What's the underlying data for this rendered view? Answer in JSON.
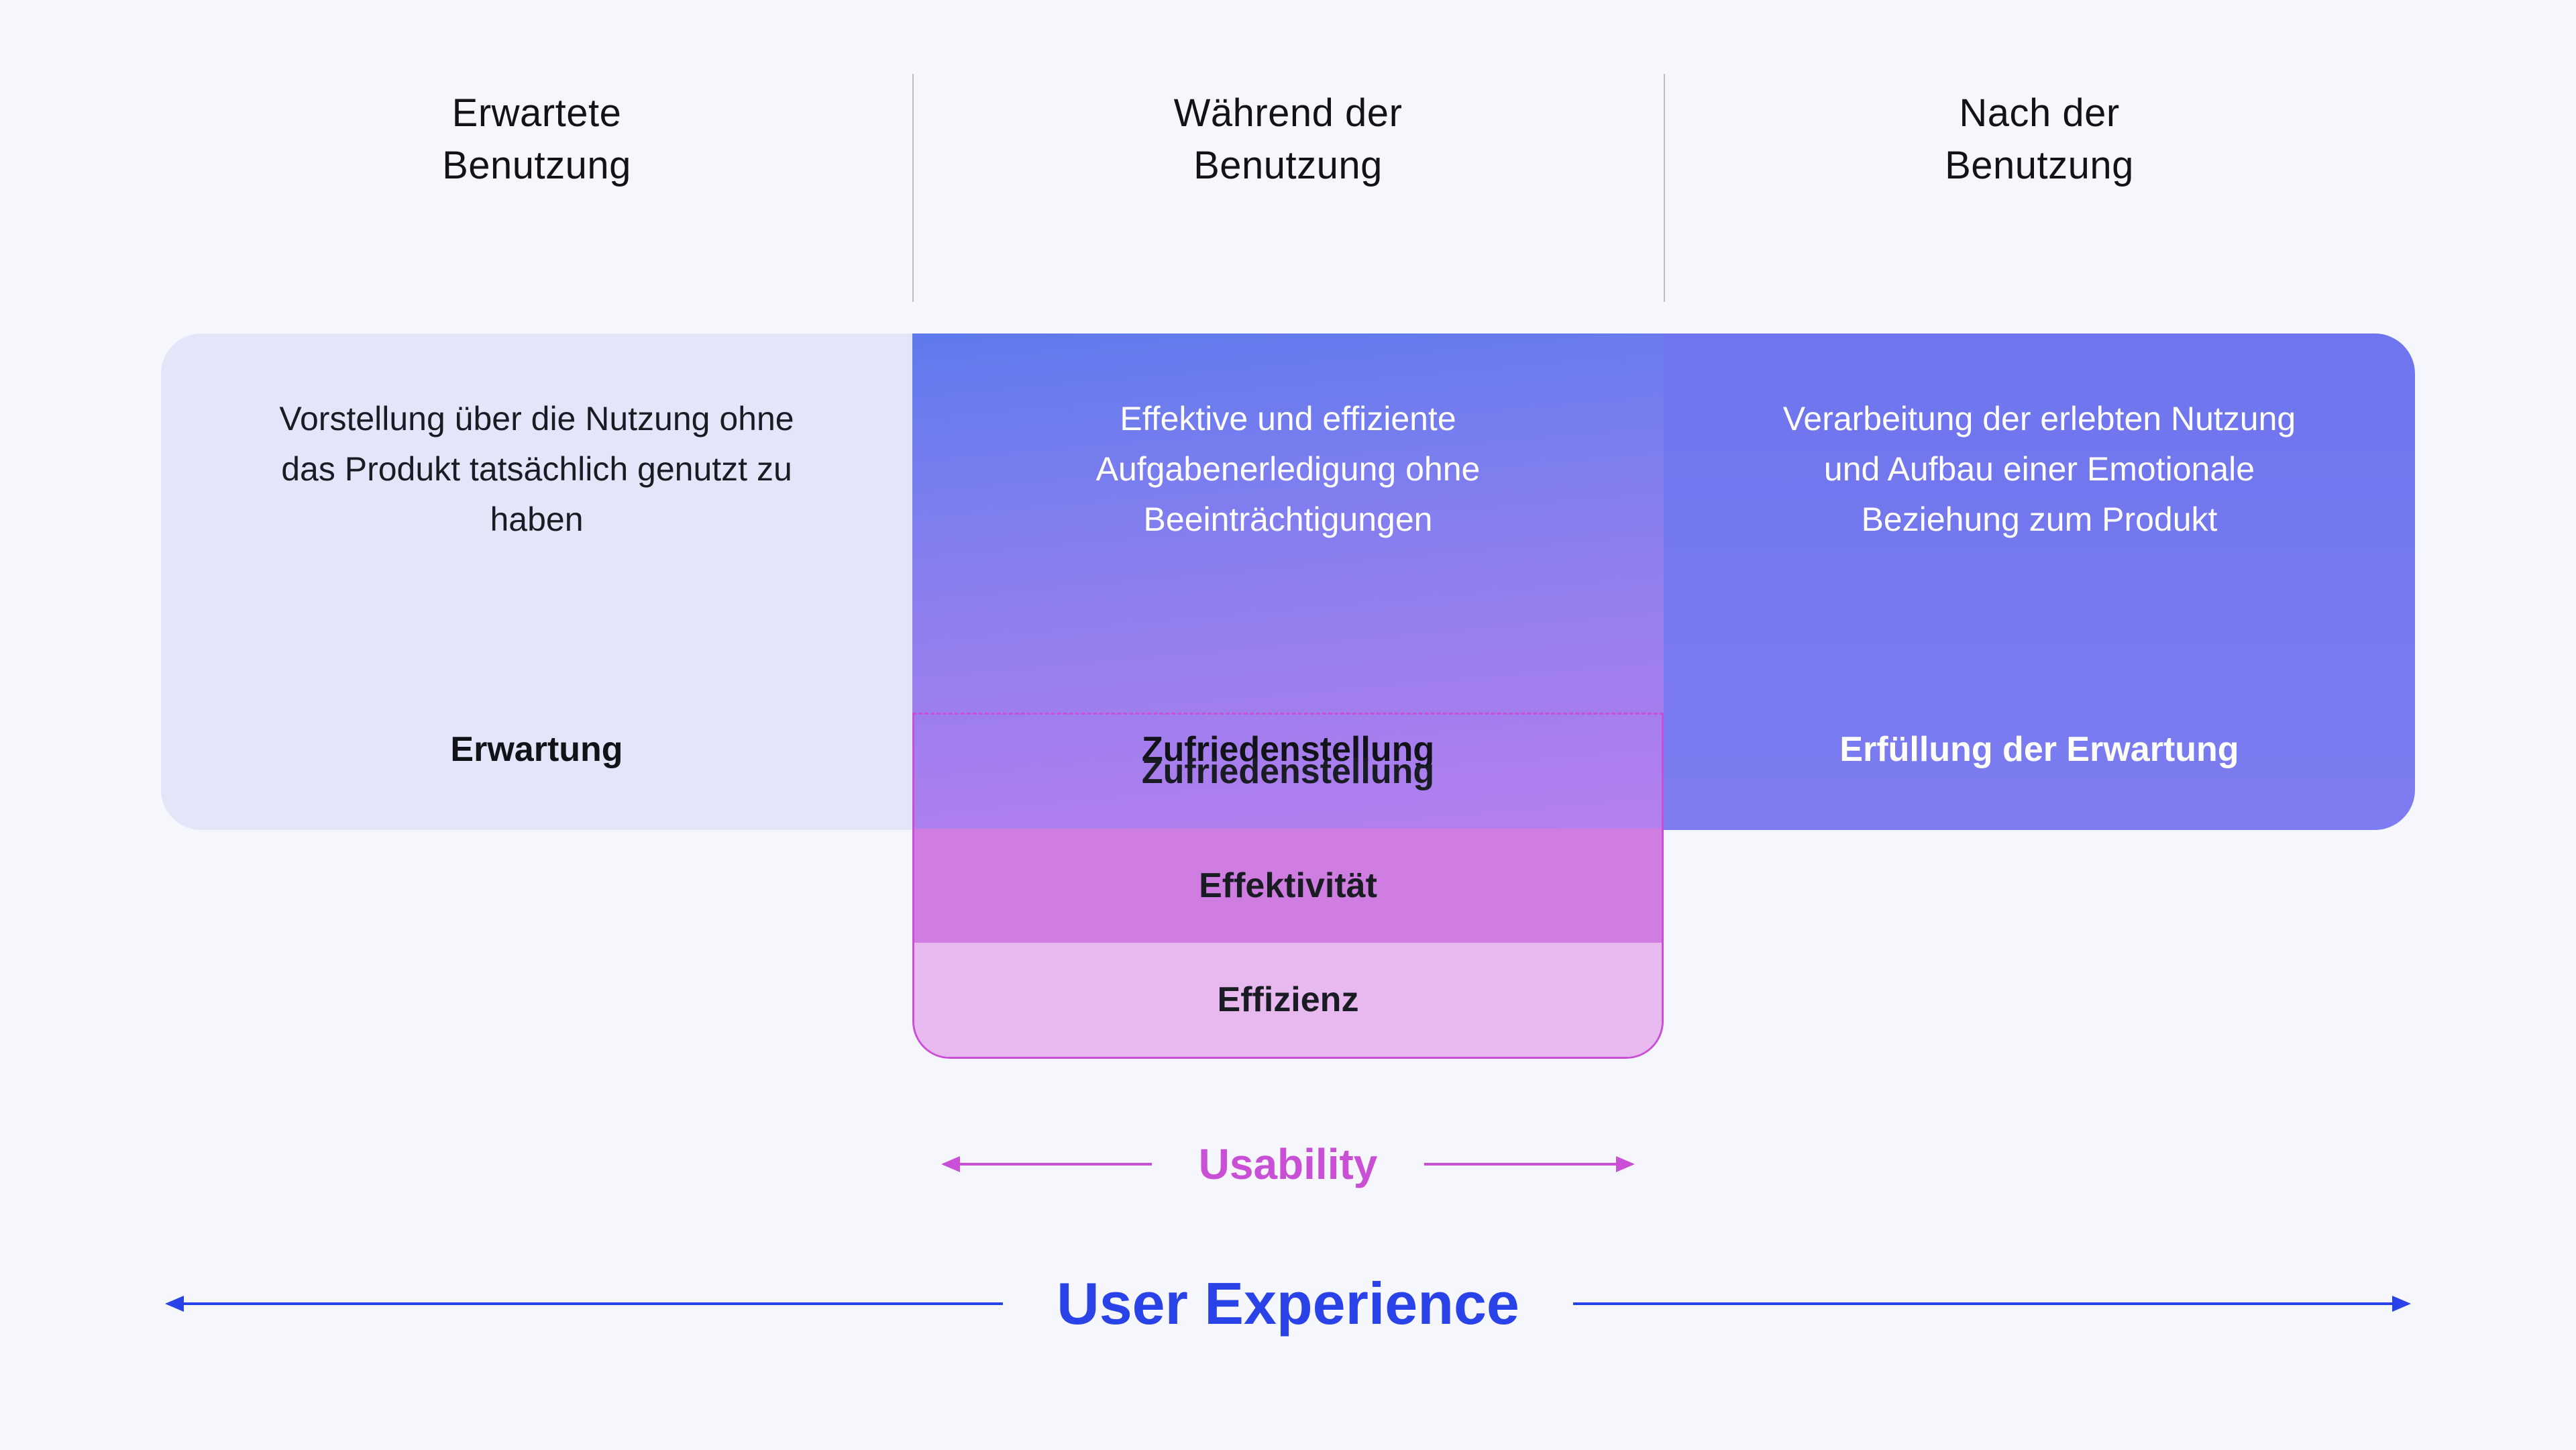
{
  "phases": {
    "before": {
      "title_line1": "Erwartete",
      "title_line2": "Benutzung",
      "description": "Vorstellung über die Nutzung ohne das Produkt tatsächlich genutzt zu haben",
      "tag": "Erwartung"
    },
    "during": {
      "title_line1": "Während der",
      "title_line2": "Benutzung",
      "description": "Effektive und effiziente Aufgabenerledigung ohne Beeinträchtigungen",
      "tag": "Zufriedenstellung"
    },
    "after": {
      "title_line1": "Nach der",
      "title_line2": "Benutzung",
      "description": "Verarbeitung der erlebten Nutzung und Aufbau einer Emotionale Beziehung zum Produkt",
      "tag": "Erfüllung der Erwartung"
    }
  },
  "usability": {
    "rows": {
      "r1": "Zufriedenstellung",
      "r2": "Effektivität",
      "r3": "Effizienz"
    },
    "label": "Usability"
  },
  "ux_label": "User Experience",
  "colors": {
    "usability": "#c84fd6",
    "ux": "#2a43e8"
  }
}
